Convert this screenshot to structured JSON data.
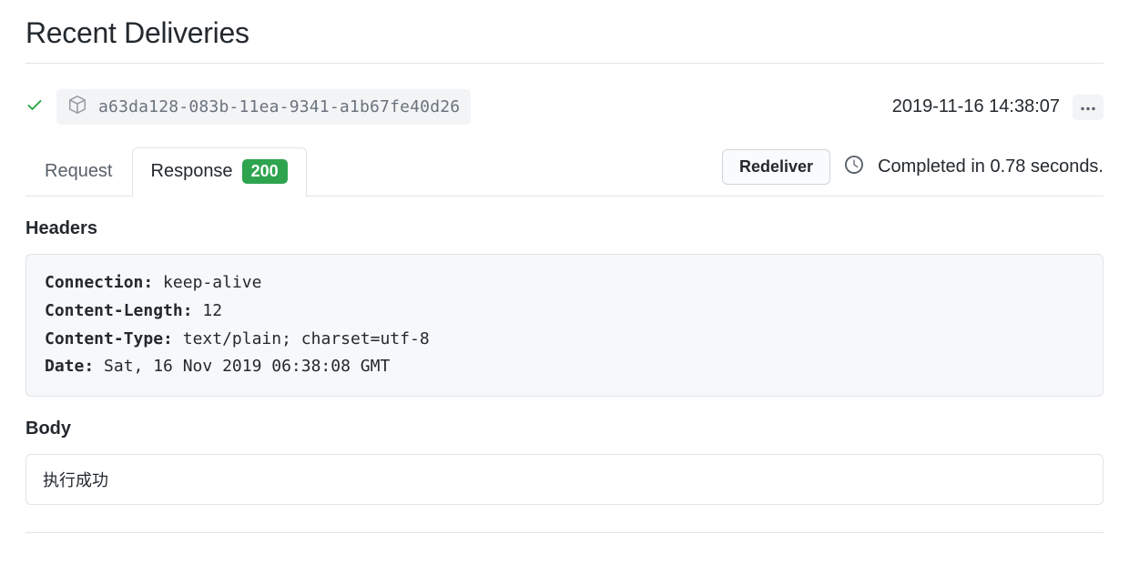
{
  "title": "Recent Deliveries",
  "delivery": {
    "id": "a63da128-083b-11ea-9341-a1b67fe40d26",
    "timestamp": "2019-11-16 14:38:07"
  },
  "tabs": {
    "request": "Request",
    "response": "Response",
    "status_code": "200"
  },
  "actions": {
    "redeliver": "Redeliver",
    "completed": "Completed in 0.78 seconds."
  },
  "headers_section": {
    "title": "Headers",
    "items": [
      {
        "key": "Connection:",
        "value": "keep-alive"
      },
      {
        "key": "Content-Length:",
        "value": "12"
      },
      {
        "key": "Content-Type:",
        "value": "text/plain; charset=utf-8"
      },
      {
        "key": "Date:",
        "value": "Sat, 16 Nov 2019 06:38:08 GMT"
      }
    ]
  },
  "body_section": {
    "title": "Body",
    "content": "执行成功"
  }
}
